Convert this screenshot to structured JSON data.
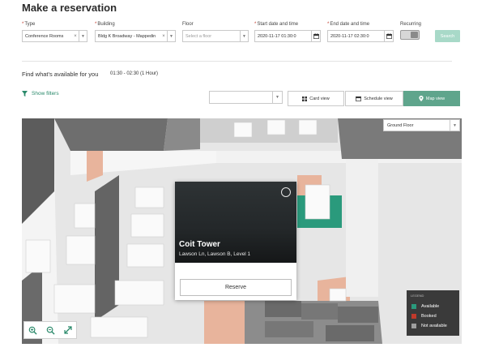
{
  "page": {
    "title": "Make a reservation"
  },
  "form": {
    "type": {
      "label": "Type",
      "value": "Conference Rooms"
    },
    "building": {
      "label": "Building",
      "value": "Bldg K Broadway - Mappedin"
    },
    "floor": {
      "label": "Floor",
      "placeholder": "Select a floor"
    },
    "start": {
      "label": "Start date and time",
      "value": "2020-11-17 01:30:0"
    },
    "end": {
      "label": "End date and time",
      "value": "2020-11-17 02:30:0"
    },
    "recurring": {
      "label": "Recurring"
    },
    "search_label": "Search"
  },
  "availability": {
    "heading": "Find what's available for you",
    "time_range": "01:30 - 02:30 (1 Hour)"
  },
  "filters": {
    "label": "Show filters"
  },
  "views": [
    {
      "label": "Card view",
      "icon": "grid-icon",
      "active": false
    },
    {
      "label": "Schedule view",
      "icon": "calendar-icon",
      "active": false
    },
    {
      "label": "Map view",
      "icon": "map-pin-icon",
      "active": true
    }
  ],
  "map": {
    "floor_value": "Ground Floor",
    "popup": {
      "title": "Coit Tower",
      "subtitle": "Lawson Ln, Lawson B, Level 1",
      "reserve_label": "Reserve"
    },
    "legend": {
      "title": "LEGEND",
      "items": [
        {
          "label": "Available",
          "color": "#2a9a7c"
        },
        {
          "label": "Booked",
          "color": "#c0392b"
        },
        {
          "label": "Not available",
          "color": "#9e9e9e"
        }
      ]
    }
  },
  "colors": {
    "accent": "#5fa58c",
    "search_disabled": "#a8d9c8",
    "room_available": "#2a9a7c",
    "room_booked": "#e8b49c"
  }
}
